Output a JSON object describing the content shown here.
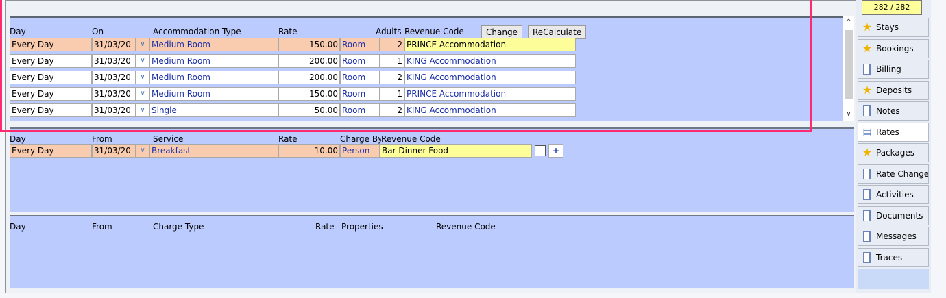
{
  "rates_table": {
    "headers": {
      "day": "Day",
      "on": "On",
      "type": "Accommodation Type",
      "rate": "Rate",
      "adults": "Adults",
      "revenue": "Revenue Code"
    },
    "buttons": {
      "change": "Change",
      "recalculate": "ReCalculate"
    },
    "rows": [
      {
        "day": "Every Day",
        "date": "31/03/20",
        "type": "Medium Room",
        "rate": "150.00",
        "unit": "Room",
        "adults": "2",
        "revenue": "PRINCE Accommodation",
        "selected": true
      },
      {
        "day": "Every Day",
        "date": "31/03/20",
        "type": "Medium Room",
        "rate": "200.00",
        "unit": "Room",
        "adults": "1",
        "revenue": "KING Accommodation",
        "selected": false
      },
      {
        "day": "Every Day",
        "date": "31/03/20",
        "type": "Medium Room",
        "rate": "200.00",
        "unit": "Room",
        "adults": "2",
        "revenue": "KING Accommodation",
        "selected": false
      },
      {
        "day": "Every Day",
        "date": "31/03/20",
        "type": "Medium Room",
        "rate": "150.00",
        "unit": "Room",
        "adults": "1",
        "revenue": "PRINCE Accommodation",
        "selected": false
      },
      {
        "day": "Every Day",
        "date": "31/03/20",
        "type": "Single",
        "rate": "50.00",
        "unit": "Room",
        "adults": "2",
        "revenue": "KING Accommodation",
        "selected": false
      }
    ]
  },
  "services_table": {
    "headers": {
      "day": "Day",
      "from": "From",
      "service": "Service",
      "rate": "Rate",
      "charge_by": "Charge By",
      "revenue": "Revenue Code"
    },
    "rows": [
      {
        "day": "Every Day",
        "date": "31/03/20",
        "service": "Breakfast",
        "rate": "10.00",
        "charge_by": "Person",
        "revenue": "Bar Dinner Food",
        "plus": "+"
      }
    ]
  },
  "charges_table": {
    "headers": {
      "day": "Day",
      "from": "From",
      "charge_type": "Charge Type",
      "rate": "Rate",
      "properties": "Properties",
      "revenue": "Revenue Code"
    }
  },
  "sidebar": {
    "counter": "282 / 282",
    "items": [
      {
        "label": "Stays",
        "icon": "star-icon"
      },
      {
        "label": "Bookings",
        "icon": "star-icon"
      },
      {
        "label": "Billing",
        "icon": "document-icon"
      },
      {
        "label": "Deposits",
        "icon": "star-icon"
      },
      {
        "label": "Notes",
        "icon": "document-icon"
      },
      {
        "label": "Rates",
        "icon": "chat-icon",
        "active": true
      },
      {
        "label": "Packages",
        "icon": "star-icon"
      },
      {
        "label": "Rate Change",
        "icon": "document-icon"
      },
      {
        "label": "Activities",
        "icon": "document-icon"
      },
      {
        "label": "Documents",
        "icon": "document-icon"
      },
      {
        "label": "Messages",
        "icon": "document-icon"
      },
      {
        "label": "Traces",
        "icon": "document-icon"
      }
    ]
  },
  "colors": {
    "selected_row": "#f9ccb0",
    "selected_revenue": "#fdfd9a",
    "panel": "#bccbfd",
    "highlight": "#ff2a6f",
    "link_text": "#1a2fa8"
  }
}
